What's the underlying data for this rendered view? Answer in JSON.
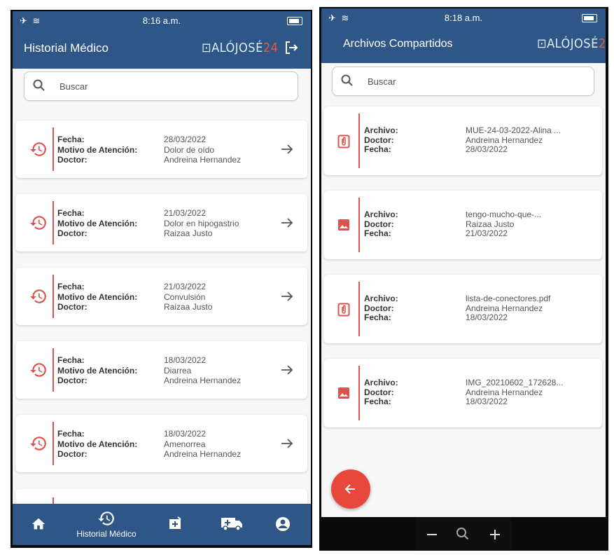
{
  "left": {
    "status": {
      "time": "8:16 a.m."
    },
    "header": {
      "title": "Historial Médico",
      "logo_text": "ALÓJOSÉ",
      "logo_num": "24"
    },
    "search": {
      "placeholder": "Buscar"
    },
    "labels": {
      "fecha": "Fecha:",
      "motivo": "Motivo de Atención:",
      "doctor": "Doctor:"
    },
    "records": [
      {
        "fecha": "28/03/2022",
        "motivo": "Dolor de oído",
        "doctor": "Andreina Hernandez"
      },
      {
        "fecha": "21/03/2022",
        "motivo": "Dolor en hipogastrio",
        "doctor": "Raizaa Justo"
      },
      {
        "fecha": "21/03/2022",
        "motivo": "Convulsión",
        "doctor": "Raizaa Justo"
      },
      {
        "fecha": "18/03/2022",
        "motivo": "Diarrea",
        "doctor": "Andreina Hernandez"
      },
      {
        "fecha": "18/03/2022",
        "motivo": "Amenorrea",
        "doctor": "Andreina Hernandez"
      }
    ],
    "bottom_nav": {
      "active_label": "Historial Médico"
    }
  },
  "right": {
    "status": {
      "time": "8:18 a.m."
    },
    "header": {
      "title": "Archivos Compartidos",
      "logo_text": "ALÓJOSÉ",
      "logo_num": "24"
    },
    "search": {
      "placeholder": "Buscar"
    },
    "labels": {
      "archivo": "Archivo:",
      "doctor": "Doctor:",
      "fecha": "Fecha:"
    },
    "files": [
      {
        "icon": "file-attachment-icon",
        "archivo": "MUE-24-03-2022-Alina ...",
        "doctor": "Andreina Hernandez",
        "fecha": "28/03/2022"
      },
      {
        "icon": "image-icon",
        "archivo": "tengo-mucho-que-...",
        "doctor": "Raizaa Justo",
        "fecha": "21/03/2022"
      },
      {
        "icon": "file-attachment-icon",
        "archivo": "lista-de-conectores.pdf",
        "doctor": "Andreina Hernandez",
        "fecha": "18/03/2022"
      },
      {
        "icon": "image-icon",
        "archivo": "IMG_20210602_172628...",
        "doctor": "Andreina Hernandez",
        "fecha": "18/03/2022"
      }
    ]
  },
  "colors": {
    "primary": "#2e5686",
    "accent": "#d9534f",
    "fab": "#e8483c"
  }
}
